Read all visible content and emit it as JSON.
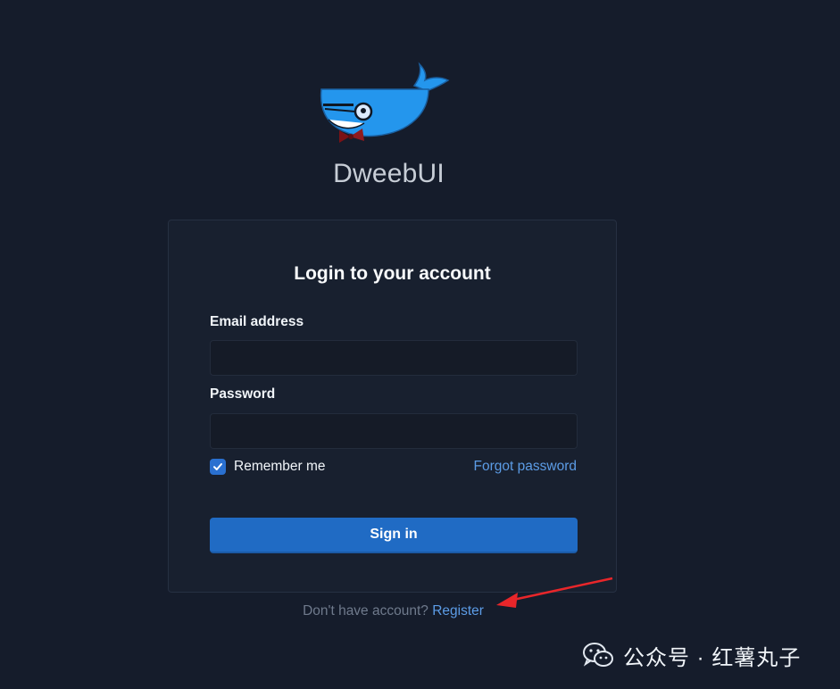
{
  "brand": {
    "name": "DweebUI",
    "logo_icon": "whale-logo-icon"
  },
  "login": {
    "title": "Login to your account",
    "email_label": "Email address",
    "email_value": "",
    "password_label": "Password",
    "password_value": "",
    "remember_label": "Remember me",
    "remember_checked": true,
    "forgot_label": "Forgot password",
    "signin_label": "Sign in"
  },
  "register": {
    "prompt": "Don't have account?",
    "link_label": "Register"
  },
  "watermark": {
    "text": "公众号 · 红薯丸子",
    "icon": "wechat-icon"
  },
  "colors": {
    "background": "#151c2b",
    "card": "#18202f",
    "primary": "#206bc4",
    "link": "#5c9ce6",
    "annotation_arrow": "#e8262a"
  }
}
